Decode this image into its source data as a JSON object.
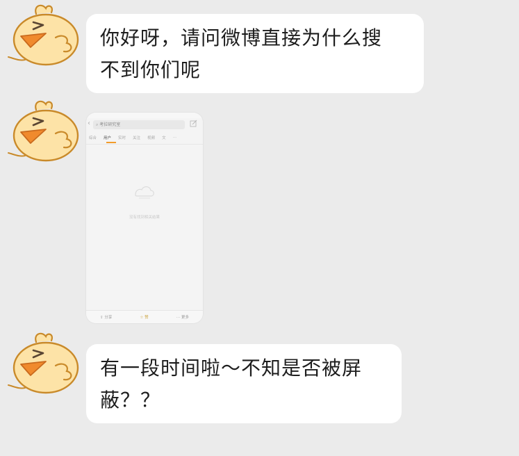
{
  "messages": [
    {
      "lines": [
        "你好呀，请问微博直接为什么搜",
        "不到你们呢"
      ]
    },
    {
      "lines": [
        "有一段时间啦～不知是否被屏",
        "蔽？？"
      ]
    }
  ],
  "screenshot": {
    "search_text": "考拉研究室",
    "tabs": [
      "综合",
      "用户",
      "实时",
      "关注",
      "视频",
      "文",
      "…"
    ],
    "empty_text": "没有找到相关结果",
    "bottom": {
      "share": "分享",
      "like": "赞",
      "more": "更多"
    }
  },
  "colors": {
    "background": "#ebebeb",
    "bubble": "#ffffff",
    "avatar_yellow": "#fde3a7",
    "avatar_outline": "#c98a2a",
    "beak": "#f08a2d"
  },
  "icons": {
    "avatar": "yellow-chick-avatar",
    "edit": "edit-icon",
    "back": "back-arrow-icon",
    "empty": "empty-result-icon"
  }
}
